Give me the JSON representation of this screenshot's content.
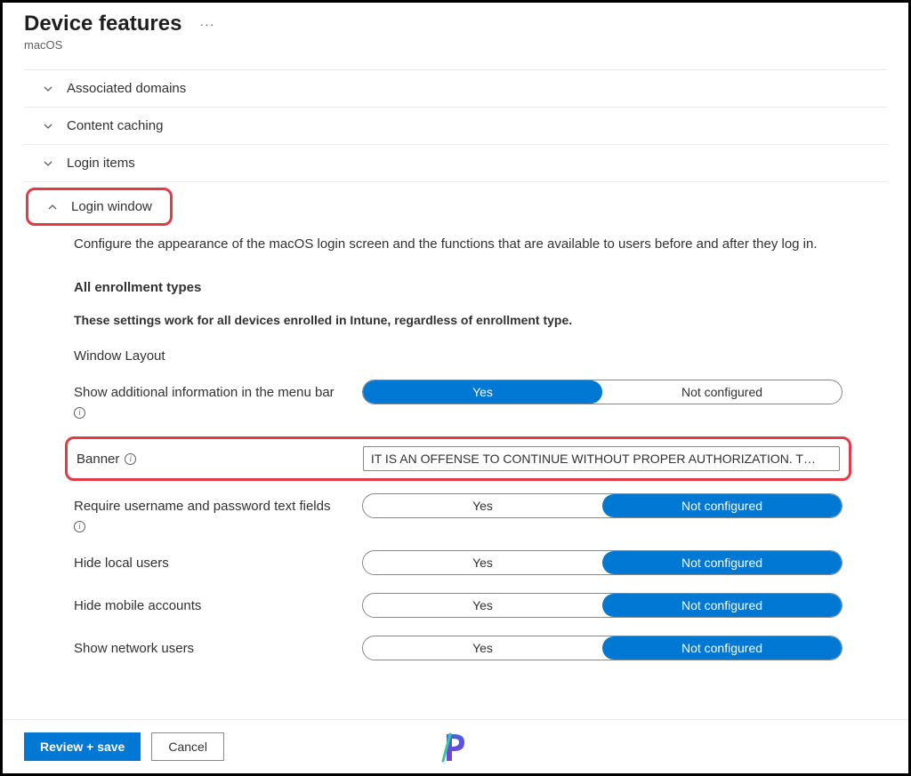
{
  "header": {
    "title": "Device features",
    "subtitle": "macOS"
  },
  "sections": {
    "associated_domains": "Associated domains",
    "content_caching": "Content caching",
    "login_items": "Login items",
    "login_window": "Login window"
  },
  "login_window": {
    "description": "Configure the appearance of the macOS login screen and the functions that are available to users before and after they log in.",
    "enroll_heading": "All enrollment types",
    "enroll_note": "These settings work for all devices enrolled in Intune, regardless of enrollment type.",
    "group_label": "Window Layout",
    "settings": {
      "menu_bar_info": {
        "label": "Show additional information in the menu bar",
        "yes": "Yes",
        "not": "Not configured",
        "selected": "yes"
      },
      "banner": {
        "label": "Banner",
        "value": "IT IS AN OFFENSE TO CONTINUE WITHOUT PROPER AUTHORIZATION. T…"
      },
      "require_user_pass": {
        "label": "Require username and password text fields",
        "yes": "Yes",
        "not": "Not configured",
        "selected": "not"
      },
      "hide_local": {
        "label": "Hide local users",
        "yes": "Yes",
        "not": "Not configured",
        "selected": "not"
      },
      "hide_mobile": {
        "label": "Hide mobile accounts",
        "yes": "Yes",
        "not": "Not configured",
        "selected": "not"
      },
      "show_network": {
        "label": "Show network users",
        "yes": "Yes",
        "not": "Not configured",
        "selected": "not"
      }
    }
  },
  "footer": {
    "review": "Review + save",
    "cancel": "Cancel"
  }
}
